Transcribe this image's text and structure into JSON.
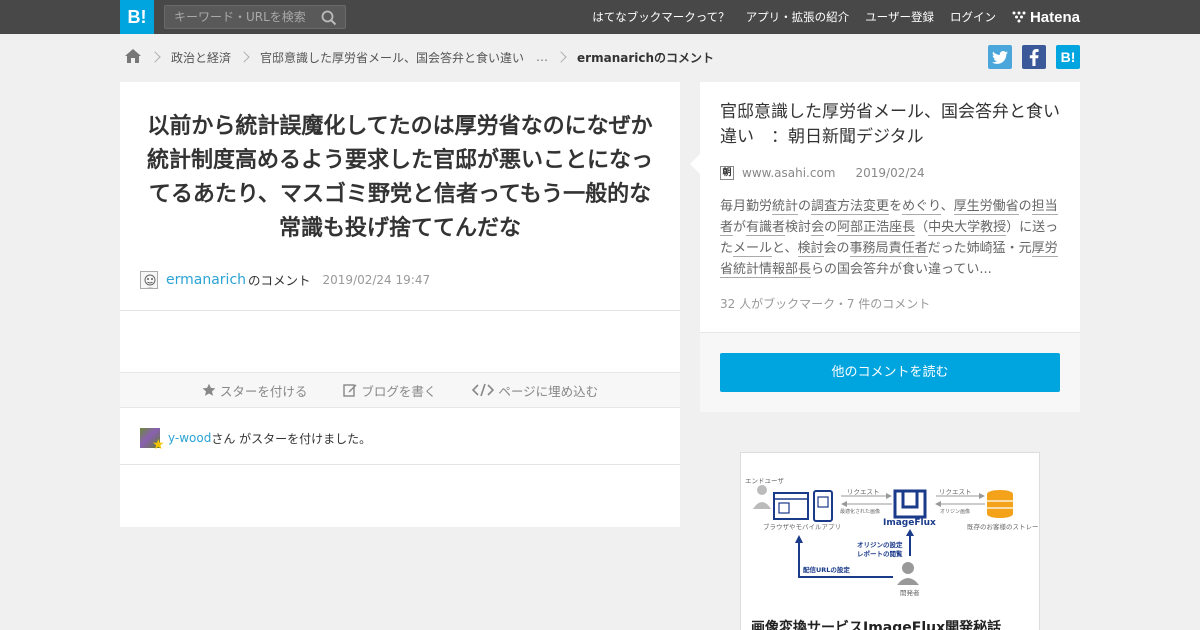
{
  "header": {
    "logo": "B!",
    "search_placeholder": "キーワード・URLを検索",
    "nav": [
      "はてなブックマークって？",
      "アプリ・拡張の紹介",
      "ユーザー登録",
      "ログイン"
    ],
    "brand": "Hatena"
  },
  "breadcrumb": {
    "items": [
      "政治と経済",
      "官邸意識した厚労省メール、国会答弁と食い違い"
    ],
    "ellipsis": "…",
    "current": "ermanarichのコメント"
  },
  "share": {
    "twitter_icon": "twitter-icon",
    "facebook_icon": "facebook-icon",
    "hatena_label": "B!"
  },
  "comment": {
    "text": "以前から統計誤魔化してたのは厚労省なのになぜか統計制度高めるよう要求した官邸が悪いことになってるあたり、マスゴミ野党と信者ってもう一般的な常識も投げ捨ててんだな",
    "user": "ermanarich",
    "user_suffix": "のコメント",
    "date": "2019/02/24 19:47"
  },
  "actions": {
    "star": "スターを付ける",
    "blog": "ブログを書く",
    "embed": "ページに埋め込む"
  },
  "star_notice": {
    "user": "y-wood",
    "text": "さん がスターを付けました。"
  },
  "entry": {
    "title": "官邸意識した厚労省メール、国会答弁と食い違い　：朝日新聞デジタル",
    "favicon_char": "朝",
    "site": "www.asahi.com",
    "date": "2019/02/24",
    "summary": [
      {
        "t": "毎月勤労",
        "k": false
      },
      {
        "t": "統計",
        "k": true
      },
      {
        "t": "の",
        "k": false
      },
      {
        "t": "調査方法変更",
        "k": true
      },
      {
        "t": "を",
        "k": false
      },
      {
        "t": "めぐり",
        "k": true
      },
      {
        "t": "、",
        "k": false
      },
      {
        "t": "厚生労働省",
        "k": true
      },
      {
        "t": "の",
        "k": false
      },
      {
        "t": "担当者",
        "k": true
      },
      {
        "t": "が",
        "k": false
      },
      {
        "t": "有識者",
        "k": true
      },
      {
        "t": "検討",
        "k": false
      },
      {
        "t": "会",
        "k": true
      },
      {
        "t": "の",
        "k": false
      },
      {
        "t": "阿部正浩座長",
        "k": true
      },
      {
        "t": "（",
        "k": false
      },
      {
        "t": "中央大学",
        "k": true
      },
      {
        "t": "教授",
        "k": true
      },
      {
        "t": "）に送った",
        "k": false
      },
      {
        "t": "メール",
        "k": true
      },
      {
        "t": "と、",
        "k": false
      },
      {
        "t": "検討",
        "k": true
      },
      {
        "t": "会の",
        "k": false
      },
      {
        "t": "事務局",
        "k": true
      },
      {
        "t": "責任者",
        "k": true
      },
      {
        "t": "だった姉崎猛・元",
        "k": false
      },
      {
        "t": "厚労省統計情報部長",
        "k": true
      },
      {
        "t": "らの国会答弁が食い違ってい...",
        "k": false
      }
    ],
    "stats": "32 人がブックマーク・7 件のコメント",
    "read_button": "他のコメントを読む"
  },
  "ad": {
    "title": "画像変換サービスImageFlux開発秘話",
    "diagram": {
      "end_user": "エンドユーザ",
      "client": "ブラウザやモバイルアプリ",
      "request": "リクエスト",
      "response": "最適化された画像",
      "product": "ImageFlux",
      "origin_request": "リクエスト",
      "origin_sub": "オリジン画像",
      "storage": "既存のお客様のストレージ",
      "settings": "オリジンの設定\nレポートの閲覧",
      "url_setting": "配信URLの設定",
      "developer": "開発者"
    }
  },
  "colors": {
    "header_bg": "#484848",
    "accent": "#00a4de",
    "link": "#2aa3d5",
    "twitter": "#4aa6db",
    "facebook": "#3b5998"
  }
}
